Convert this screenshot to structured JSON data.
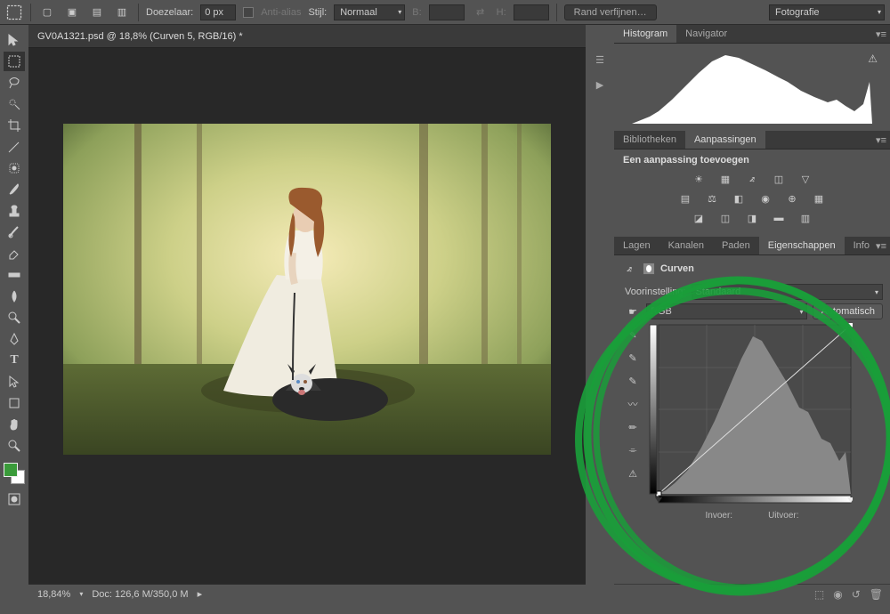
{
  "options": {
    "feather_label": "Doezelaar:",
    "feather_value": "0 px",
    "antialias": "Anti-alias",
    "style_label": "Stijl:",
    "style_value": "Normaal",
    "width_label": "B:",
    "height_label": "H:",
    "refine": "Rand verfijnen…",
    "workspace": "Fotografie"
  },
  "document": {
    "tab": "GV0A1321.psd @ 18,8% (Curven 5, RGB/16) *",
    "zoom": "18,84%",
    "status": "Doc: 126,6 M/350,0 M"
  },
  "panels": {
    "histogram_tab": "Histogram",
    "navigator_tab": "Navigator",
    "bibliotheken_tab": "Bibliotheken",
    "aanpassingen_tab": "Aanpassingen",
    "add_adjustment": "Een aanpassing toevoegen",
    "lagen_tab": "Lagen",
    "kanalen_tab": "Kanalen",
    "paden_tab": "Paden",
    "eigenschappen_tab": "Eigenschappen",
    "info_tab": "Info"
  },
  "properties": {
    "kind": "Curven",
    "preset_label": "Voorinstelling:",
    "preset_value": "Standaard",
    "channel": "RGB",
    "auto": "Automatisch",
    "input_label": "Invoer:",
    "output_label": "Uitvoer:"
  }
}
